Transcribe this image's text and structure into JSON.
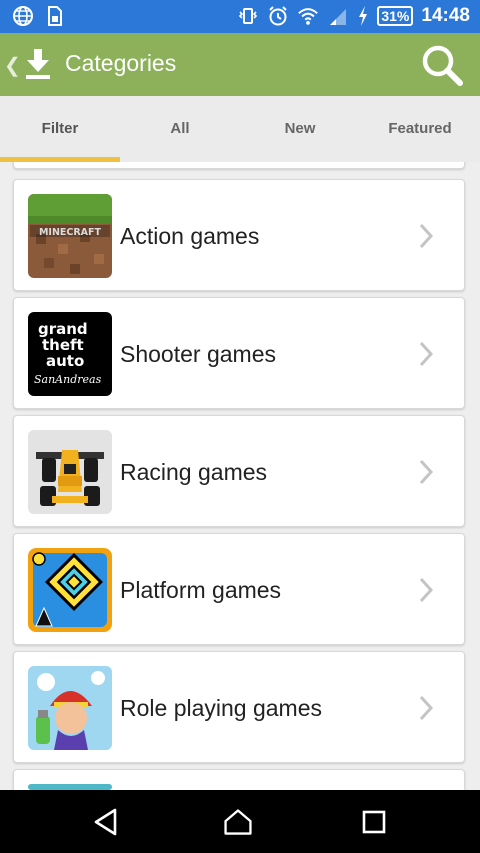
{
  "status_bar": {
    "battery": "31%",
    "time": "14:48",
    "icons": [
      "globe-icon",
      "sim-icon",
      "vibrate-icon",
      "alarm-icon",
      "wifi-icon",
      "signal-icon",
      "charging-icon"
    ]
  },
  "app_bar": {
    "title": "Categories",
    "icons": [
      "back-chevron-icon",
      "download-icon",
      "search-icon"
    ],
    "color": "#8cb15a"
  },
  "tabs": [
    {
      "label": "Filter",
      "active": true
    },
    {
      "label": "All",
      "active": false
    },
    {
      "label": "New",
      "active": false
    },
    {
      "label": "Featured",
      "active": false
    }
  ],
  "categories": [
    {
      "label": "Action games",
      "icon": "minecraft-thumbnail"
    },
    {
      "label": "Shooter games",
      "icon": "gta-san-andreas-thumbnail"
    },
    {
      "label": "Racing games",
      "icon": "race-car-thumbnail"
    },
    {
      "label": "Platform games",
      "icon": "geometry-dash-thumbnail"
    },
    {
      "label": "Role playing games",
      "icon": "subway-surfers-thumbnail"
    }
  ],
  "thumbnail_text": {
    "minecraft": "MINECRAFT",
    "gta": [
      "grand",
      "theft",
      "auto",
      "SanAndreas"
    ]
  },
  "nav_bar": {
    "icons": [
      "back-triangle-icon",
      "home-icon",
      "recents-icon"
    ]
  },
  "colors": {
    "status_bar": "#2b78d8",
    "tab_indicator": "#f0c040"
  }
}
